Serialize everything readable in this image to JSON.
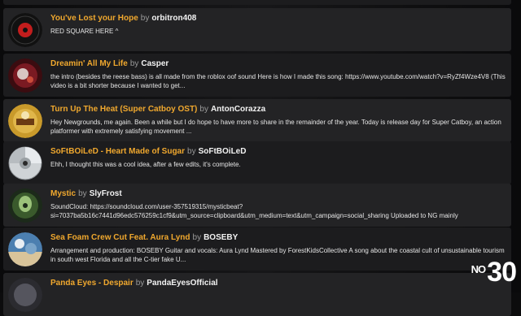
{
  "items": [
    {
      "title": "You've Lost your Hope",
      "by": "by",
      "author": "orbitron408",
      "desc": "RED SQUARE HERE ^"
    },
    {
      "title": "Dreamin' All My Life",
      "by": "by",
      "author": "Casper",
      "desc": "the intro (besides the reese bass) is all made from the roblox oof sound Here is how I made this song: https://www.youtube.com/watch?v=RyZf4Wze4V8 (This video is a bit shorter because I wanted to get..."
    },
    {
      "title": "Turn Up The Heat (Super Catboy OST)",
      "by": "by",
      "author": "AntonCorazza",
      "desc": "Hey Newgrounds, me again. Been a while but I do hope to have more to share in the remainder of the year. Today is release day for Super Catboy, an action platformer with extremely satisfying movement ..."
    },
    {
      "title": "SoFtBOiLeD - Heart Made of Sugar",
      "by": "by",
      "author": "SoFtBOiLeD",
      "desc": "Ehh, I thought this was a cool idea, after a few edits, it's complete."
    },
    {
      "title": "Mystic",
      "by": "by",
      "author": "SlyFrost",
      "desc": "SoundCloud: https://soundcloud.com/user-357519315/mysticbeat?si=7037ba5b16c7441d96edc576259c1cf9&utm_source=clipboard&utm_medium=text&utm_campaign=social_sharing Uploaded to NG mainly"
    },
    {
      "title": "Sea Foam Crew Cut Feat. Aura Lynd",
      "by": "by",
      "author": "BOSEBY",
      "desc": "Arrangement and production: BOSEBY Guitar and vocals: Aura Lynd Mastered by ForestKidsCollective A song about the coastal cult of unsustainable tourism in south west Florida and all the C-tier fake U..."
    },
    {
      "title": "Panda Eyes - Despair",
      "by": "by",
      "author": "PandaEyesOfficial",
      "desc": ""
    }
  ],
  "badge": {
    "prefix": "NO",
    "number": "30"
  }
}
